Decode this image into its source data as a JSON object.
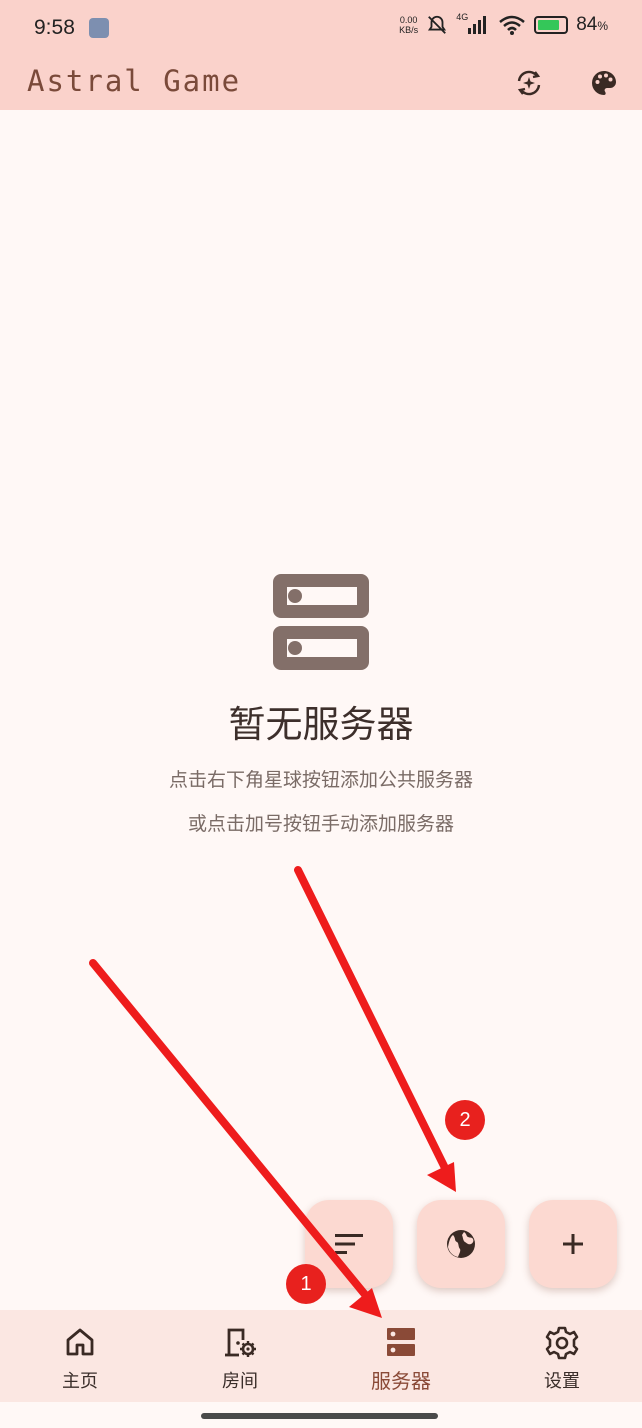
{
  "status_bar": {
    "time": "9:58",
    "speed_value": "0.00",
    "speed_unit": "KB/s",
    "network": "4G",
    "battery": "84",
    "battery_unit": "%"
  },
  "app_bar": {
    "title": "Astral Game",
    "icons": [
      "sparkle-sync-icon",
      "palette-icon"
    ]
  },
  "empty_state": {
    "icon": "server-icon",
    "title": "暂无服务器",
    "line1": "点击右下角星球按钮添加公共服务器",
    "line2": "或点击加号按钮手动添加服务器"
  },
  "fabs": [
    "sort-icon",
    "globe-icon",
    "plus-icon"
  ],
  "nav": {
    "items": [
      {
        "label": "主页",
        "icon": "home-icon"
      },
      {
        "label": "房间",
        "icon": "room-settings-icon"
      },
      {
        "label": "服务器",
        "icon": "server-icon",
        "active": true
      },
      {
        "label": "设置",
        "icon": "gear-icon"
      }
    ]
  },
  "annotations": {
    "badge1": "1",
    "badge2": "2",
    "color": "#e8211e"
  },
  "colors": {
    "bar_bg": "#fad2cb",
    "page_bg": "#fff8f6",
    "fab_bg": "#fcd9d1",
    "accent": "#8a4a37"
  }
}
